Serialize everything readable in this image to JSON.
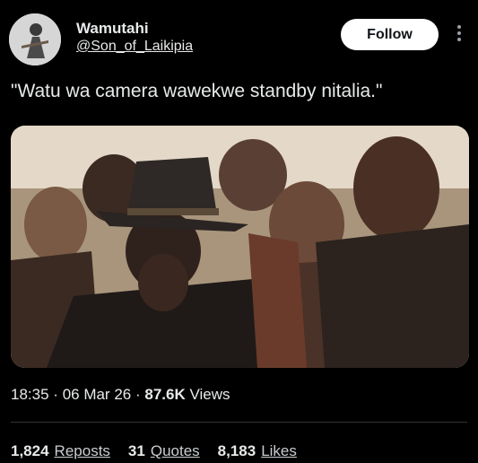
{
  "header": {
    "display_name": "Wamutahi",
    "handle": "@Son_of_Laikipia",
    "follow_label": "Follow"
  },
  "tweet": {
    "text": "\"Watu wa camera wawekwe standby nitalia.\""
  },
  "meta": {
    "time": "18:35",
    "date": "06 Mar 26",
    "views_count": "87.6K",
    "views_label": "Views",
    "separator": "·"
  },
  "stats": [
    {
      "count": "1,824",
      "label": "Reposts"
    },
    {
      "count": "31",
      "label": "Quotes"
    },
    {
      "count": "8,183",
      "label": "Likes"
    }
  ],
  "icons": {
    "avatar": "user-avatar",
    "more": "more-vertical-icon"
  }
}
